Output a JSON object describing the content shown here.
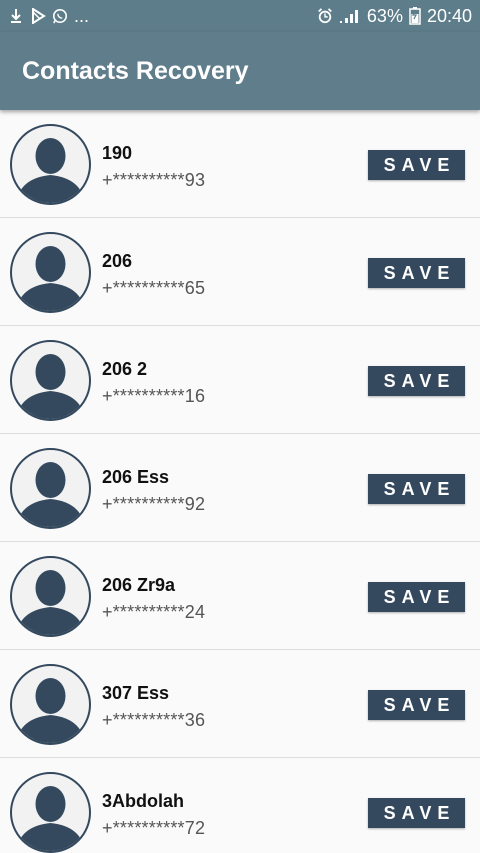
{
  "status_bar": {
    "left_icons": [
      "download-icon",
      "play-store-icon",
      "whatsapp-icon"
    ],
    "more_indicator": "...",
    "battery_percent": "63%",
    "time": "20:40",
    "right_icons": [
      "alarm-icon",
      "signal-icon",
      "battery-icon"
    ]
  },
  "app_bar": {
    "title": "Contacts Recovery"
  },
  "contacts": [
    {
      "name": "190",
      "phone": "+**********93",
      "button": "SAVE"
    },
    {
      "name": "206",
      "phone": "+**********65",
      "button": "SAVE"
    },
    {
      "name": "206 2",
      "phone": "+**********16",
      "button": "SAVE"
    },
    {
      "name": "206 Ess",
      "phone": "+**********92",
      "button": "SAVE"
    },
    {
      "name": "206 Zr9a",
      "phone": "+**********24",
      "button": "SAVE"
    },
    {
      "name": "307 Ess",
      "phone": "+**********36",
      "button": "SAVE"
    },
    {
      "name": "3Abdolah",
      "phone": "+**********72",
      "button": "SAVE"
    }
  ],
  "colors": {
    "app_bar": "#607d8b",
    "status_bar": "#5e7d8a",
    "button": "#34495e",
    "avatar_silhouette": "#34495e"
  }
}
